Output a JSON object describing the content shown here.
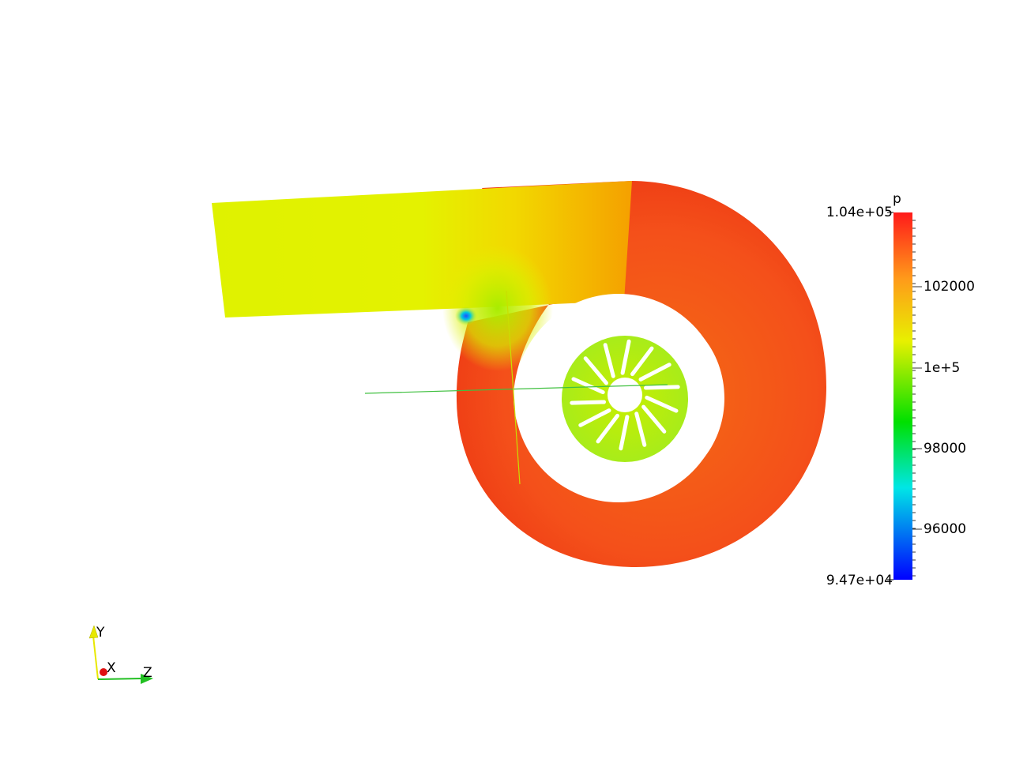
{
  "scalar_bar": {
    "title": "p",
    "max_label": "1.04e+05",
    "min_label": "9.47e+04",
    "ticks": [
      "102000",
      "1e+5",
      "98000",
      "96000"
    ],
    "range": [
      94700,
      104000
    ],
    "colormap": "blue-cyan-green-yellow-red"
  },
  "orientation_axes": {
    "x_label": "X",
    "y_label": "Y",
    "z_label": "Z",
    "colors": {
      "x": "#e01010",
      "y": "#e8e800",
      "z": "#22c022"
    }
  },
  "colors": {
    "background": "#ffffff",
    "high_pressure": "#f0401a",
    "mid_pressure": "#e4f000",
    "low_pressure": "#1060ff",
    "slice_lines": "#40c040"
  }
}
